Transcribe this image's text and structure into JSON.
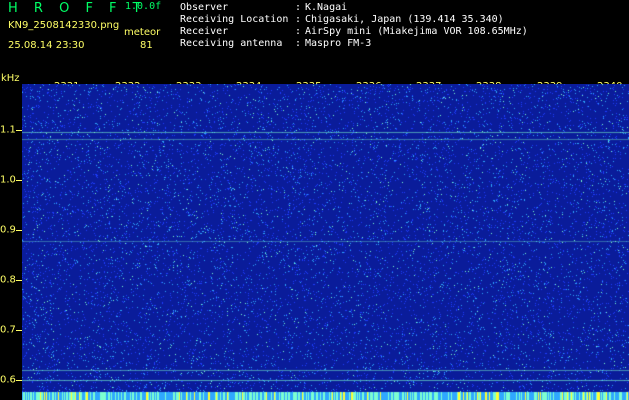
{
  "header": {
    "logo": "H R O F F T",
    "version": "1.0.0f",
    "filename": "KN9_2508142330.png",
    "timestamp": "25.08.14 23:30",
    "meteor_label": "meteor",
    "meteor_count": "81"
  },
  "info": [
    {
      "label": "Observer",
      "value": "K.Nagai"
    },
    {
      "label": "Receiving Location",
      "value": "Chigasaki, Japan (139.414 35.340)"
    },
    {
      "label": "Receiver",
      "value": "AirSpy mini (Miakejima VOR 108.65MHz)"
    },
    {
      "label": "Receiving antenna",
      "value": "Maspro FM-3"
    }
  ],
  "plot": {
    "y_unit": "kHz",
    "y_ticks": [
      "1.1",
      "1.0",
      "0.9",
      "0.8",
      "0.7",
      "0.6"
    ],
    "x_ticks": [
      "2331",
      "2332",
      "2333",
      "2334",
      "2335",
      "2336",
      "2337",
      "2338",
      "2339",
      "2340"
    ],
    "colors": {
      "background": "#0a1c9a",
      "noise_low": "#1e3cff",
      "noise_mid": "#2fa8ff",
      "noise_high": "#7dffd0",
      "axis_text": "#ffff66"
    }
  }
}
